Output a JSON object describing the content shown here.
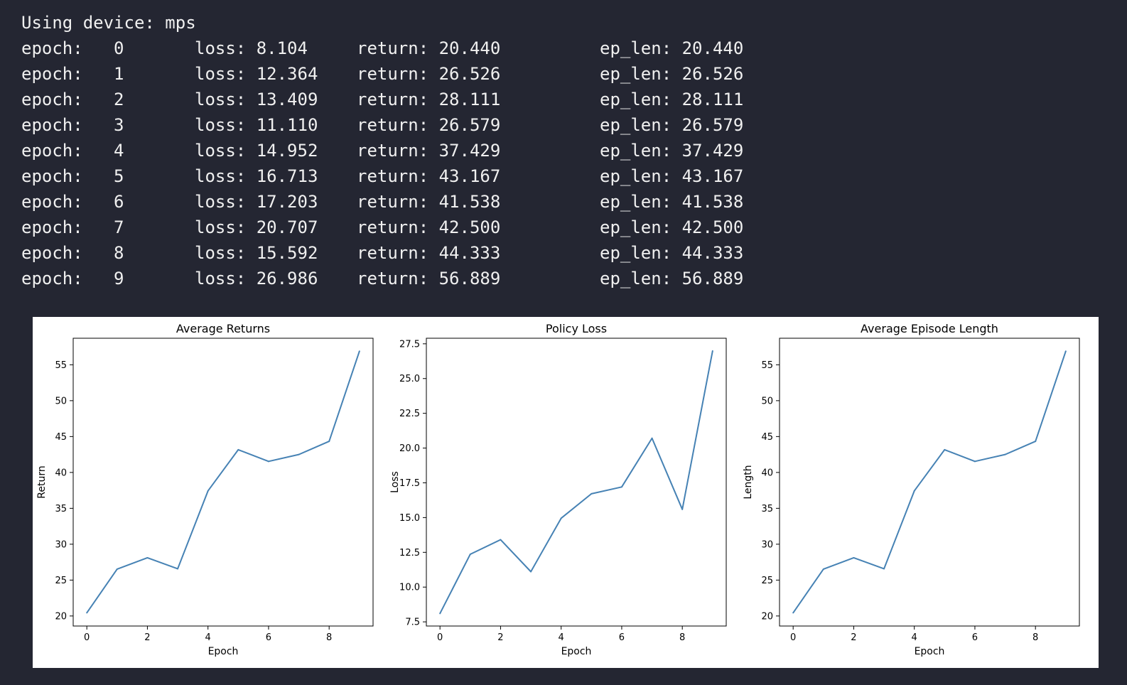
{
  "terminal": {
    "header": "Using device: mps",
    "rows": [
      {
        "epoch": "epoch:   0",
        "loss": "loss: 8.104",
        "ret": "return: 20.440",
        "eplen": "ep_len: 20.440"
      },
      {
        "epoch": "epoch:   1",
        "loss": "loss: 12.364",
        "ret": "return: 26.526",
        "eplen": "ep_len: 26.526"
      },
      {
        "epoch": "epoch:   2",
        "loss": "loss: 13.409",
        "ret": "return: 28.111",
        "eplen": "ep_len: 28.111"
      },
      {
        "epoch": "epoch:   3",
        "loss": "loss: 11.110",
        "ret": "return: 26.579",
        "eplen": "ep_len: 26.579"
      },
      {
        "epoch": "epoch:   4",
        "loss": "loss: 14.952",
        "ret": "return: 37.429",
        "eplen": "ep_len: 37.429"
      },
      {
        "epoch": "epoch:   5",
        "loss": "loss: 16.713",
        "ret": "return: 43.167",
        "eplen": "ep_len: 43.167"
      },
      {
        "epoch": "epoch:   6",
        "loss": "loss: 17.203",
        "ret": "return: 41.538",
        "eplen": "ep_len: 41.538"
      },
      {
        "epoch": "epoch:   7",
        "loss": "loss: 20.707",
        "ret": "return: 42.500",
        "eplen": "ep_len: 42.500"
      },
      {
        "epoch": "epoch:   8",
        "loss": "loss: 15.592",
        "ret": "return: 44.333",
        "eplen": "ep_len: 44.333"
      },
      {
        "epoch": "epoch:   9",
        "loss": "loss: 26.986",
        "ret": "return: 56.889",
        "eplen": "ep_len: 56.889"
      }
    ]
  },
  "chart_data": [
    {
      "type": "line",
      "title": "Average Returns",
      "xlabel": "Epoch",
      "ylabel": "Return",
      "x": [
        0,
        1,
        2,
        3,
        4,
        5,
        6,
        7,
        8,
        9
      ],
      "values": [
        20.44,
        26.526,
        28.111,
        26.579,
        37.429,
        43.167,
        41.538,
        42.5,
        44.333,
        56.889
      ],
      "xlim": [
        -0.45,
        9.45
      ],
      "ylim": [
        18.6,
        58.7
      ],
      "xticks": [
        0,
        2,
        4,
        6,
        8
      ],
      "yticks": [
        20,
        25,
        30,
        35,
        40,
        45,
        50,
        55
      ],
      "ytick_decimals": 0,
      "color": "#4682b4"
    },
    {
      "type": "line",
      "title": "Policy Loss",
      "xlabel": "Epoch",
      "ylabel": "Loss",
      "x": [
        0,
        1,
        2,
        3,
        4,
        5,
        6,
        7,
        8,
        9
      ],
      "values": [
        8.104,
        12.364,
        13.409,
        11.11,
        14.952,
        16.713,
        17.203,
        20.707,
        15.592,
        26.986
      ],
      "xlim": [
        -0.45,
        9.45
      ],
      "ylim": [
        7.2,
        27.9
      ],
      "xticks": [
        0,
        2,
        4,
        6,
        8
      ],
      "yticks": [
        7.5,
        10.0,
        12.5,
        15.0,
        17.5,
        20.0,
        22.5,
        25.0,
        27.5
      ],
      "ytick_decimals": 1,
      "color": "#4682b4"
    },
    {
      "type": "line",
      "title": "Average Episode Length",
      "xlabel": "Epoch",
      "ylabel": "Length",
      "x": [
        0,
        1,
        2,
        3,
        4,
        5,
        6,
        7,
        8,
        9
      ],
      "values": [
        20.44,
        26.526,
        28.111,
        26.579,
        37.429,
        43.167,
        41.538,
        42.5,
        44.333,
        56.889
      ],
      "xlim": [
        -0.45,
        9.45
      ],
      "ylim": [
        18.6,
        58.7
      ],
      "xticks": [
        0,
        2,
        4,
        6,
        8
      ],
      "yticks": [
        20,
        25,
        30,
        35,
        40,
        45,
        50,
        55
      ],
      "ytick_decimals": 0,
      "color": "#4682b4"
    }
  ]
}
